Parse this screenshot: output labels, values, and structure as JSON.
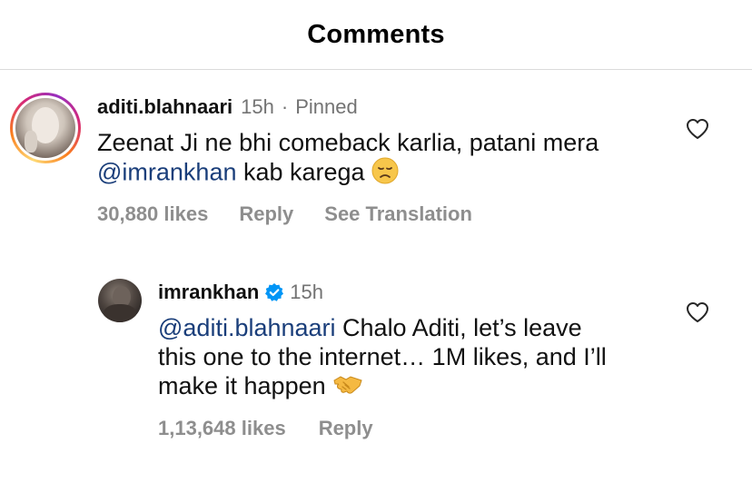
{
  "header": {
    "title": "Comments"
  },
  "comments": [
    {
      "username": "aditi.blahnaari",
      "time": "15h",
      "pinned_label": "Pinned",
      "text_line1": "Zeenat Ji ne bhi comeback karlia, patani mera",
      "mention": "@imrankhan",
      "text_line2_rest": " kab karega ",
      "emoji": "disappointed-face-emoji",
      "likes": "30,880 likes",
      "reply_label": "Reply",
      "translation_label": "See Translation",
      "has_story_ring": true
    },
    {
      "username": "imrankhan",
      "verified": true,
      "time": "15h",
      "mention": "@aditi.blahnaari",
      "text_line1_rest": " Chalo Aditi, let’s leave",
      "text_line2": "this one to the internet… 1M likes, and I’ll",
      "text_line3": "make it happen ",
      "emoji": "handshake-emoji",
      "likes": "1,13,648 likes",
      "reply_label": "Reply"
    }
  ],
  "colors": {
    "mention": "#1a3e7a",
    "secondary_text": "#737373",
    "action_text": "#8e8e8e",
    "verified_badge": "#0095f6",
    "divider": "#dbdbdb"
  }
}
